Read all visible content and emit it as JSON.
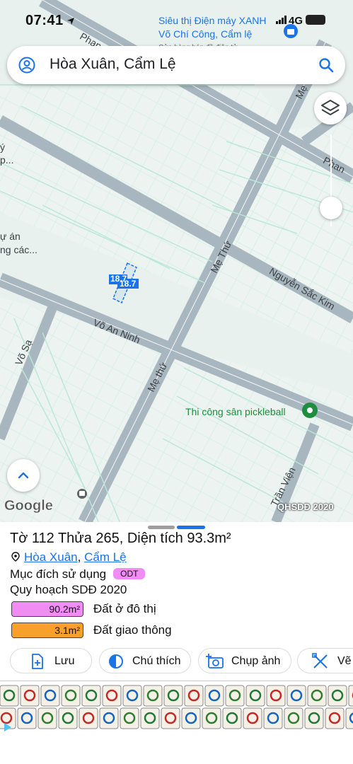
{
  "status_bar": {
    "time": "07:41",
    "network": "4G"
  },
  "search": {
    "query": "Hòa Xuân, Cẩm Lệ"
  },
  "map": {
    "poi_top": {
      "name": "Siêu thị Điện máy XANH",
      "area": "Võ Chí Công, Cẩm lệ",
      "sub": "Cửa hàng bán đồ điện tử"
    },
    "streets": [
      "Phan",
      "Phan",
      "Mẹ",
      "Mẹ Thứ",
      "Nguyễn Sắc Kim",
      "Võ An Ninh",
      "Võ Sạ",
      "Mẹ thứ",
      "Trần Viện"
    ],
    "left_labels": [
      "ý",
      "p...",
      "ự án",
      "ng các..."
    ],
    "parcel_number": "18.7",
    "poi": "Thi công sân pickleball",
    "google": "Google",
    "plan_tag": "QHSDĐ 2020"
  },
  "sheet": {
    "title": "Tờ 112 Thửa 265, Diện tích 93.3m²",
    "ward": "Hòa Xuân",
    "separator": ",",
    "district": "Cẩm Lệ",
    "purpose_label": "Mục đích sử dụng",
    "purpose_code": "ODT",
    "plan_title": "Quy hoạch SDĐ 2020",
    "legend": [
      {
        "area": "90.2m²",
        "label": "Đất ở đô thị",
        "color": "#f28cf5"
      },
      {
        "area": "3.1m²",
        "label": "Đất giao thông",
        "color": "#f7a12a"
      }
    ],
    "actions": {
      "save": "Lưu",
      "notes": "Chú thích",
      "photo": "Chụp ảnh",
      "draw": "Vẽ"
    }
  },
  "colors": {
    "accent": "#1a73e8",
    "map_bg": "#e9f1ef",
    "road": "#a8b6bf",
    "parcel_line": "#b9e8d6"
  }
}
